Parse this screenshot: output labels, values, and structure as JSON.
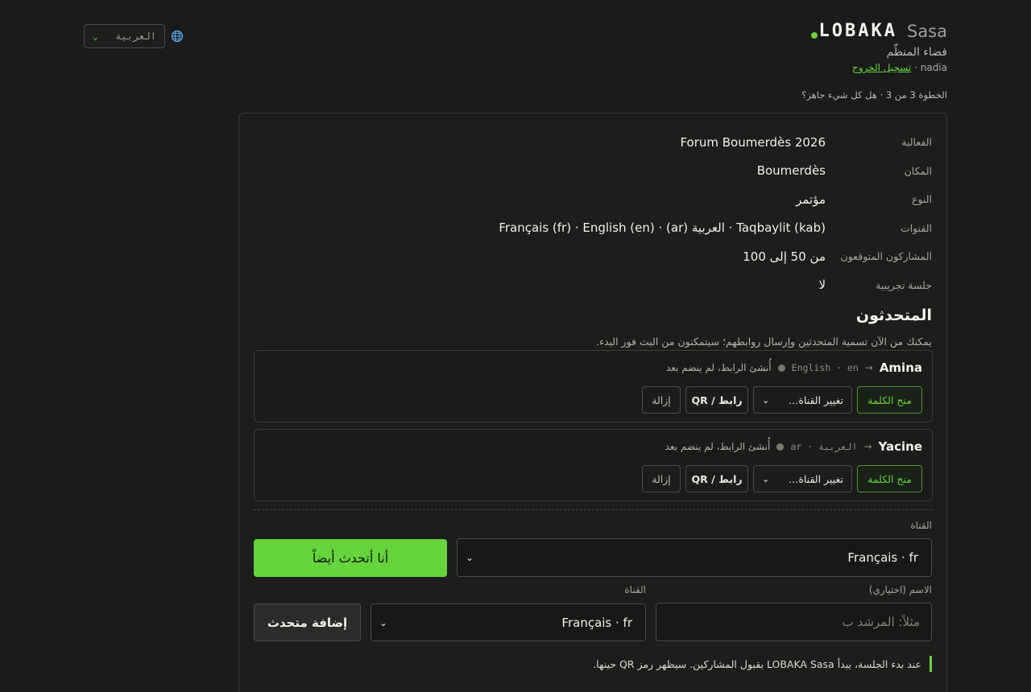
{
  "language_switcher": {
    "selected": "العربية",
    "icon": "globe-icon"
  },
  "brand": {
    "logo": "LOBAKA",
    "logo_suffix": "Sasa",
    "space_name": "فضاء المنظّم",
    "user": "nadia",
    "separator": "·",
    "logout": "تسجيل الخروج"
  },
  "step": "الخطوة 3 من 3 · هل كل شيء جاهز؟",
  "summary": [
    {
      "label": "الفعالية",
      "value": "Forum Boumerdès 2026"
    },
    {
      "label": "المكان",
      "value": "Boumerdès"
    },
    {
      "label": "النوع",
      "value": "مؤتمر"
    },
    {
      "label": "القنوات",
      "value": "Taqbaylit (kab) · العربية (ar) · Français (fr) · English (en)"
    },
    {
      "label": "المشاركون المتوقعون",
      "value": "من 50 إلى 100"
    },
    {
      "label": "جلسة تجريبية",
      "value": "لا"
    }
  ],
  "speakers": {
    "title": "المتحدثون",
    "hint": "يمكنك من الآن تسمية المتحدثين وإرسال روابطهم؛ سيتمكنون من البث فور البدء.",
    "list": [
      {
        "name": "Amina",
        "arrow": "→",
        "channel": "English · en",
        "status": "أُنشئ الرابط، لم ينضم بعد"
      },
      {
        "name": "Yacine",
        "arrow": "→",
        "channel": "العربية · ar",
        "status": "أُنشئ الرابط، لم ينضم بعد"
      }
    ],
    "buttons": {
      "grant": "منح الكلمة",
      "change_channel": "تغيير القناة…",
      "link_qr": "رابط / QR",
      "remove": "إزالة"
    }
  },
  "self_speak": {
    "channel_label": "القناة",
    "channel_value": "Français · fr",
    "button": "أنا أتحدث أيضاً"
  },
  "add_speaker": {
    "name_label": "الاسم (اختياري)",
    "name_placeholder": "مثلاً: المرشد ب",
    "channel_label": "القناة",
    "channel_value": "Français · fr",
    "button": "إضافة متحدث"
  },
  "note": "عند بدء الجلسة، يبدأ LOBAKA Sasa بقبول المشاركين. سيظهر رمز QR حينها.",
  "colors": {
    "accent": "#6ad13f",
    "background": "#1a1b1a",
    "panel": "#1d1e1c"
  }
}
